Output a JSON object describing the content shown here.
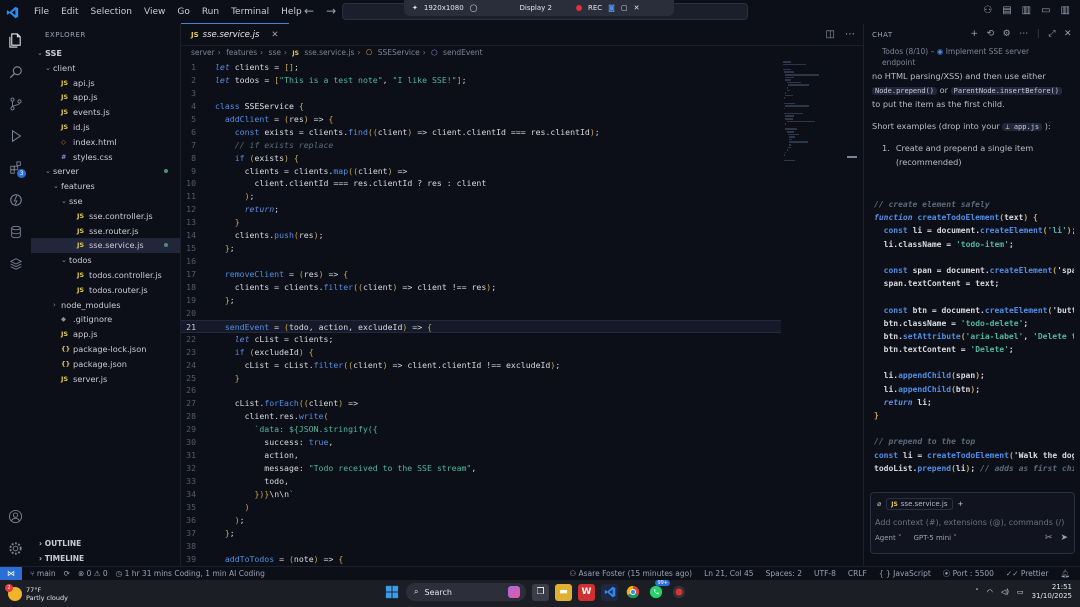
{
  "titlebar": {
    "menu": [
      "File",
      "Edit",
      "Selection",
      "View",
      "Go",
      "Run",
      "Terminal",
      "Help"
    ],
    "rec": {
      "resolution": "1920x1080",
      "display": "Display 2",
      "rec_label": "REC"
    }
  },
  "activity": {
    "extensions_badge": "3"
  },
  "explorer": {
    "header": "EXPLORER",
    "tree": [
      {
        "label": "SSE",
        "indent": 0,
        "type": "folder-open",
        "bold": true
      },
      {
        "label": "client",
        "indent": 1,
        "type": "folder-open"
      },
      {
        "label": "api.js",
        "indent": 2,
        "type": "js"
      },
      {
        "label": "app.js",
        "indent": 2,
        "type": "js"
      },
      {
        "label": "events.js",
        "indent": 2,
        "type": "js"
      },
      {
        "label": "id.js",
        "indent": 2,
        "type": "js"
      },
      {
        "label": "index.html",
        "indent": 2,
        "type": "html"
      },
      {
        "label": "styles.css",
        "indent": 2,
        "type": "css"
      },
      {
        "label": "server",
        "indent": 1,
        "type": "folder-open",
        "dot": true
      },
      {
        "label": "features",
        "indent": 2,
        "type": "folder-open"
      },
      {
        "label": "sse",
        "indent": 3,
        "type": "folder-open"
      },
      {
        "label": "sse.controller.js",
        "indent": 4,
        "type": "js"
      },
      {
        "label": "sse.router.js",
        "indent": 4,
        "type": "js"
      },
      {
        "label": "sse.service.js",
        "indent": 4,
        "type": "js",
        "selected": true,
        "dot": true
      },
      {
        "label": "todos",
        "indent": 3,
        "type": "folder-open"
      },
      {
        "label": "todos.controller.js",
        "indent": 4,
        "type": "js"
      },
      {
        "label": "todos.router.js",
        "indent": 4,
        "type": "js"
      },
      {
        "label": "node_modules",
        "indent": 2,
        "type": "folder-closed"
      },
      {
        "label": ".gitignore",
        "indent": 2,
        "type": "git"
      },
      {
        "label": "app.js",
        "indent": 2,
        "type": "js"
      },
      {
        "label": "package-lock.json",
        "indent": 2,
        "type": "json"
      },
      {
        "label": "package.json",
        "indent": 2,
        "type": "json"
      },
      {
        "label": "server.js",
        "indent": 2,
        "type": "js"
      }
    ],
    "outline": "OUTLINE",
    "timeline": "TIMELINE"
  },
  "editor": {
    "tab": "sse.service.js",
    "breadcrumb": [
      "server",
      "features",
      "sse",
      "sse.service.js",
      "SSEService",
      "sendEvent"
    ],
    "current_line": 21,
    "lines": [
      "let clients = [];",
      "let todos = [\"This is a test note\", \"I like SSE!\"];",
      "",
      "class SSEService {",
      "  addClient = (res) => {",
      "    const exists = clients.find((client) => client.clientId === res.clientId);",
      "    // if exists replace",
      "    if (exists) {",
      "      clients = clients.map((client) =>",
      "        client.clientId === res.clientId ? res : client",
      "      );",
      "      return;",
      "    }",
      "    clients.push(res);",
      "  };",
      "",
      "  removeClient = (res) => {",
      "    clients = clients.filter((client) => client !== res);",
      "  };",
      "",
      "  sendEvent = (todo, action, excludeId) => {",
      "    let cList = clients;",
      "    if (excludeId) {",
      "      cList = cList.filter((client) => client.clientId !== excludeId);",
      "    }",
      "",
      "    cList.forEach((client) =>",
      "      client.res.write(",
      "        `data: ${JSON.stringify({",
      "          success: true,",
      "          action,",
      "          message: \"Todo received to the SSE stream\",",
      "          todo,",
      "        })}\\n\\n`",
      "      )",
      "    );",
      "  };",
      "",
      "  addToTodos = (note) => {"
    ]
  },
  "chat": {
    "header": "CHAT",
    "todos_label": "Todos (8/10)",
    "todo_item": "Implement SSE server",
    "todo_item2": "endpoint",
    "intro_line1": "no HTML parsing/XSS) and then use either",
    "chip1": "Node.prepend()",
    "or": "or",
    "chip2": "ParentNode.insertBefore()",
    "intro_line3": "to put the item as the first child.",
    "examples_prefix": "Short examples (drop into your",
    "examples_file": "app.js",
    "examples_suffix": "):",
    "list_item": "Create and prepend a single item (recommended)",
    "code": [
      "// create element safely",
      "function createTodoElement(text) {",
      "  const li = document.createElement('li');",
      "  li.className = 'todo-item';",
      "",
      "  const span = document.createElement('spa",
      "  span.textContent = text;",
      "",
      "  const btn = document.createElement('butt",
      "  btn.className = 'todo-delete';",
      "  btn.setAttribute('aria-label', 'Delete todo')",
      "  btn.textContent = 'Delete';",
      "",
      "  li.appendChild(span);",
      "  li.appendChild(btn);",
      "  return li;",
      "}",
      "",
      "// prepend to the top",
      "const li = createTodoElement('Walk the dog",
      "todoList.prepend(li); // adds as first child"
    ],
    "context_file": "sse.service.js",
    "placeholder": "Add context (#), extensions (@), commands (/)",
    "agent": "Agent",
    "model": "GPT-5 mini"
  },
  "statusbar": {
    "branch": "main",
    "sync": "",
    "problems": "0",
    "warnings": "0",
    "coding": "1 hr 31 mins Coding, 1 min AI Coding",
    "author": "Asare Foster (15 minutes ago)",
    "position": "Ln 21, Col 45",
    "spaces": "Spaces: 2",
    "encoding": "UTF-8",
    "eol": "CRLF",
    "language": "JavaScript",
    "port": "Port : 5500",
    "prettier": "Prettier"
  },
  "taskbar": {
    "temp": "77°F",
    "weather": "Partly cloudy",
    "weather_badge": "2",
    "search": "Search",
    "time": "21:51",
    "date": "31/10/2025",
    "whatsapp_badge": "99+"
  },
  "colors": {
    "accent": "#2b6fd6",
    "background": "#0d0f18",
    "rec": "#e0303a"
  }
}
